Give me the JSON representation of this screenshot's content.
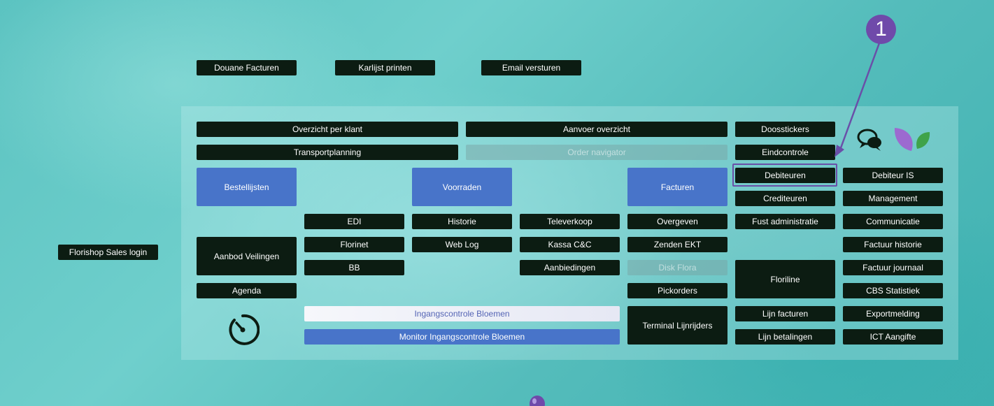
{
  "top_buttons": {
    "douane_facturen": "Douane Facturen",
    "karlijst_printen": "Karlijst printen",
    "email_versturen": "Email versturen"
  },
  "sales_login": "Florishop Sales login",
  "menu": {
    "overzicht_per_klant": "Overzicht per klant",
    "aanvoer_overzicht": "Aanvoer overzicht",
    "doosstickers": "Doosstickers",
    "transportplanning": "Transportplanning",
    "order_navigator": "Order navigator",
    "eindcontrole": "Eindcontrole",
    "bestellijsten": "Bestellijsten",
    "voorraden": "Voorraden",
    "facturen": "Facturen",
    "debiteuren": "Debiteuren",
    "debiteur_is": "Debiteur IS",
    "crediteuren": "Crediteuren",
    "management": "Management",
    "edi": "EDI",
    "historie": "Historie",
    "televerkoop": "Televerkoop",
    "overgeven": "Overgeven",
    "fust_administratie": "Fust administratie",
    "communicatie": "Communicatie",
    "aanbod_veilingen": "Aanbod Veilingen",
    "florinet": "Florinet",
    "web_log": "Web Log",
    "kassa_cc": "Kassa C&C",
    "zenden_ekt": "Zenden EKT",
    "factuur_historie": "Factuur historie",
    "bb": "BB",
    "aanbiedingen": "Aanbiedingen",
    "disk_flora": "Disk Flora",
    "floriline": "Floriline",
    "factuur_journaal": "Factuur journaal",
    "agenda": "Agenda",
    "pickorders": "Pickorders",
    "cbs_statistiek": "CBS Statistiek",
    "ingangscontrole_bloemen": "Ingangscontrole Bloemen",
    "terminal_lijnrijders": "Terminal Lijnrijders",
    "lijn_facturen": "Lijn facturen",
    "exportmelding": "Exportmelding",
    "monitor_ingangscontrole_bloemen": "Monitor Ingangscontrole Bloemen",
    "lijn_betalingen": "Lijn betalingen",
    "ict_aangifte": "ICT Aangifte"
  },
  "annotation": {
    "step_number": "1",
    "color": "#6f4aaa"
  },
  "colors": {
    "button_dark": "#0c1c12",
    "button_blue": "#4874c9",
    "logo_purple": "#9c6ad0",
    "logo_green": "#3fa34a"
  },
  "icons": [
    "chat-icon",
    "leaf-logo-icon",
    "timer-icon",
    "balloon-icon"
  ]
}
